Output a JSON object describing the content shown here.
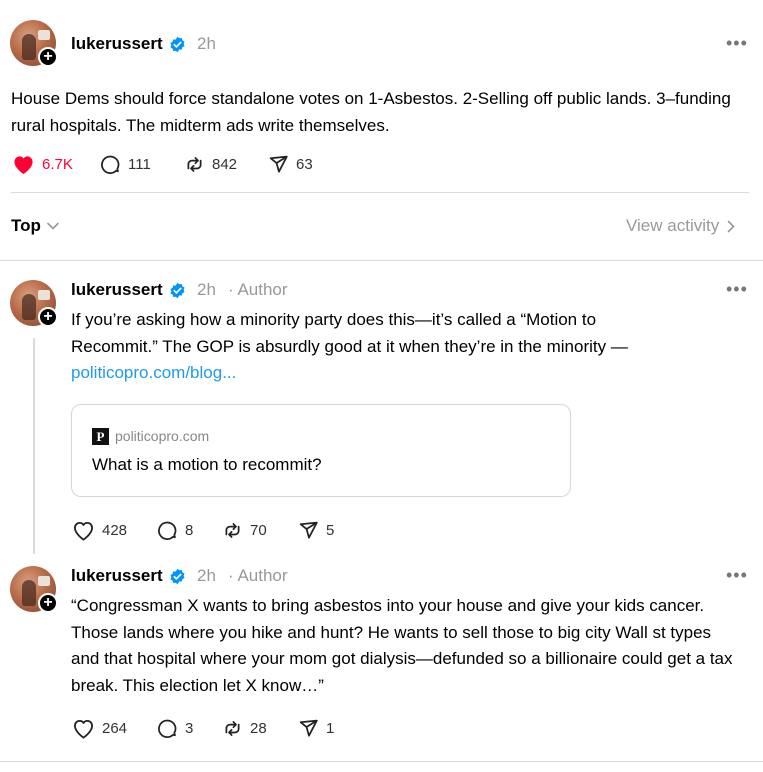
{
  "post": {
    "username": "lukerussert",
    "time": "2h",
    "text": "House Dems should force standalone votes on 1-Asbestos. 2-Selling off public lands. 3–funding rural hospitals. The midterm ads write themselves.",
    "likes": "6.7K",
    "replies": "111",
    "reposts": "842",
    "shares": "63"
  },
  "filter": {
    "sort_label": "Top",
    "view_activity": "View activity"
  },
  "replies": [
    {
      "username": "lukerussert",
      "time": "2h",
      "role": "Author",
      "text_before": "If you’re asking how a minority party does this—it’s called a “Motion to Recommit.” The GOP is absurdly good at it when they’re in the minority — ",
      "link": "politicopro.com/blog...",
      "card": {
        "favicon": "P",
        "domain": "politicopro.com",
        "title": "What is a motion to recommit?"
      },
      "likes": "428",
      "replies": "8",
      "reposts": "70",
      "shares": "5"
    },
    {
      "username": "lukerussert",
      "time": "2h",
      "role": "Author",
      "text": "“Congressman X wants to bring asbestos into your house and give your kids cancer. Those lands where you hike and hunt? He wants to sell those to big city Wall st types and that hospital where your mom got dialysis—defunded so a billionaire could get a tax break. This election let X know…”",
      "likes": "264",
      "replies": "3",
      "reposts": "28",
      "shares": "1"
    }
  ],
  "colors": {
    "heart": "#ff0034",
    "verified": "#0095f6",
    "link": "#1d9bf0"
  }
}
